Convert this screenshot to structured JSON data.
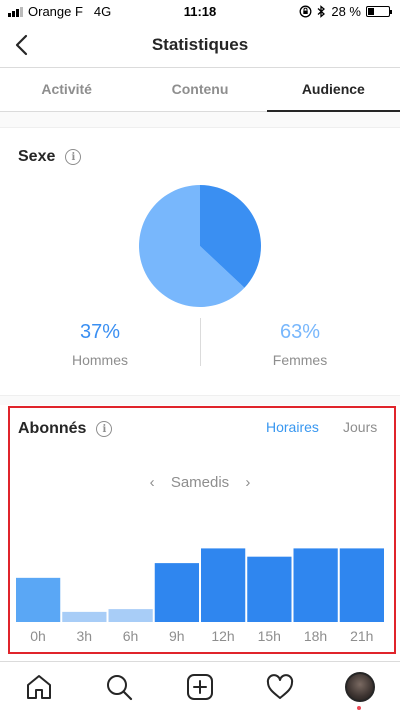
{
  "status_bar": {
    "carrier": "Orange F",
    "network": "4G",
    "time": "11:18",
    "battery_text": "28 %",
    "battery_level": 0.28
  },
  "header": {
    "title": "Statistiques",
    "back_icon": "chevron-left-icon"
  },
  "tabs": [
    {
      "label": "Activité",
      "active": false
    },
    {
      "label": "Contenu",
      "active": false
    },
    {
      "label": "Audience",
      "active": true
    }
  ],
  "sexe": {
    "title": "Sexe",
    "men_pct": "37%",
    "men_label": "Hommes",
    "women_pct": "63%",
    "women_label": "Femmes",
    "colors": {
      "men": "#3a8ff2",
      "women": "#78b7fc"
    }
  },
  "abonnes": {
    "title": "Abonnés",
    "toggle_hours": "Horaires",
    "toggle_days": "Jours",
    "day": "Samedis"
  },
  "chart_data": {
    "type": "bar",
    "categories": [
      "0h",
      "3h",
      "6h",
      "9h",
      "12h",
      "15h",
      "18h",
      "21h"
    ],
    "values": [
      48,
      11,
      14,
      64,
      80,
      71,
      80,
      80
    ],
    "ylim": [
      0,
      100
    ],
    "colors": [
      "#5aa7f5",
      "#a8cdf7",
      "#a8cdf7",
      "#2f86ef",
      "#2f86ef",
      "#2f86ef",
      "#2f86ef",
      "#2f86ef"
    ]
  },
  "highlight_color": "#e0242b",
  "bottom_nav": {
    "items": [
      "home-icon",
      "search-icon",
      "add-post-icon",
      "heart-icon",
      "profile-avatar"
    ]
  }
}
